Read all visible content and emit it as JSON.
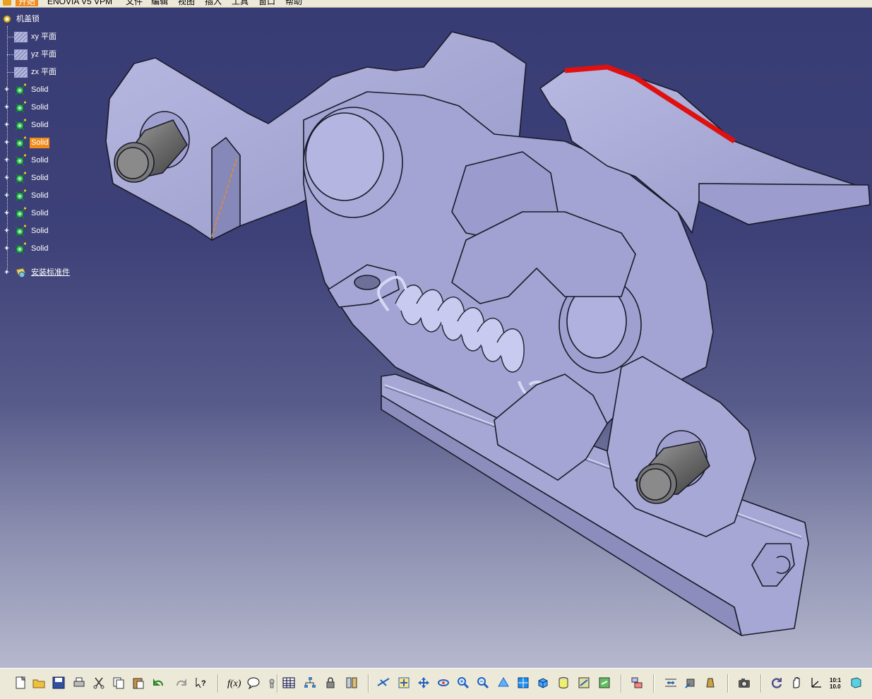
{
  "menu": {
    "start": "开始",
    "enovia": "ENOVIA V5 VPM",
    "file": "文件",
    "edit": "编辑",
    "view": "视图",
    "insert": "插入",
    "tools": "工具",
    "window": "窗口",
    "help": "帮助"
  },
  "tree": {
    "root": "机盖锁",
    "planes": [
      "xy 平面",
      "yz 平面",
      "zx 平面"
    ],
    "solids": [
      "Solid",
      "Solid",
      "Solid",
      "Solid",
      "Solid",
      "Solid",
      "Solid",
      "Solid",
      "Solid",
      "Solid"
    ],
    "selected_index": 3,
    "assembly": "安装标准件"
  },
  "colors": {
    "selection": "#f08b1c",
    "part_face": "#a2a3d3",
    "edge_highlight": "#e01010"
  },
  "toolbar_icons": [
    "new-icon",
    "open-icon",
    "save-icon",
    "print-icon",
    "cut-icon",
    "copy-icon",
    "paste-icon",
    "undo-icon",
    "redo-icon",
    "whats-this-icon",
    "formula-icon",
    "comment-icon",
    "knowledge-icon",
    "table-icon",
    "tree-graph-icon",
    "lock-icon",
    "catalog-icon",
    "fly-mode-icon",
    "fit-all-icon",
    "pan-icon",
    "rotate-icon",
    "zoom-in-icon",
    "zoom-out-icon",
    "normal-view-icon",
    "multi-view-icon",
    "iso-view-icon",
    "shading-icon",
    "hide-show-icon",
    "swap-space-icon",
    "insert-component-icon",
    "measure-icon",
    "measure-item-icon",
    "mass-icon",
    "capture-icon",
    "update-icon",
    "manipulate-icon",
    "axis-icon",
    "scale-icon",
    "view-cube-icon"
  ]
}
